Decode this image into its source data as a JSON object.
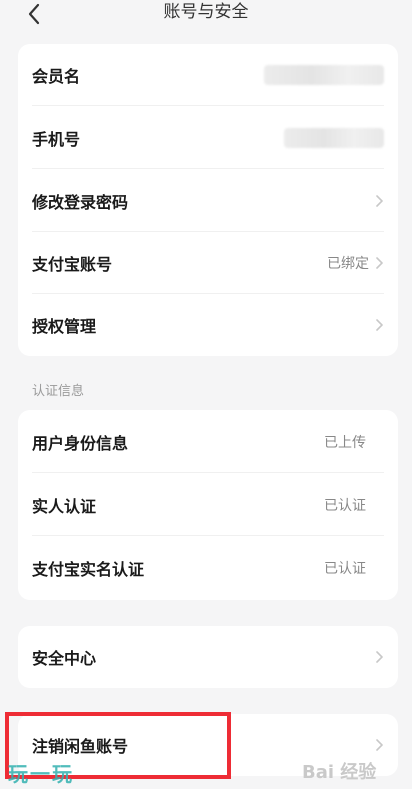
{
  "header": {
    "title": "账号与安全"
  },
  "account_card": {
    "items": [
      {
        "label": "会员名"
      },
      {
        "label": "手机号"
      },
      {
        "label": "修改登录密码"
      },
      {
        "label": "支付宝账号",
        "value": "已绑定"
      },
      {
        "label": "授权管理"
      }
    ]
  },
  "verification_section": {
    "title": "认证信息",
    "items": [
      {
        "label": "用户身份信息",
        "value": "已上传"
      },
      {
        "label": "实人认证",
        "value": "已认证"
      },
      {
        "label": "支付宝实名认证",
        "value": "已认证"
      }
    ]
  },
  "security_card": {
    "label": "安全中心"
  },
  "cancel_card": {
    "label": "注销闲鱼账号"
  },
  "watermarks": {
    "left": "玩一玩",
    "right": "Bai 经验"
  },
  "colors": {
    "highlight": "#ee2c35",
    "background": "#f5f5f6",
    "card": "#ffffff",
    "watermark_left": "#33b1b0"
  },
  "icons": {
    "back": "chevron-left-icon",
    "row_arrow": "chevron-right-icon"
  }
}
